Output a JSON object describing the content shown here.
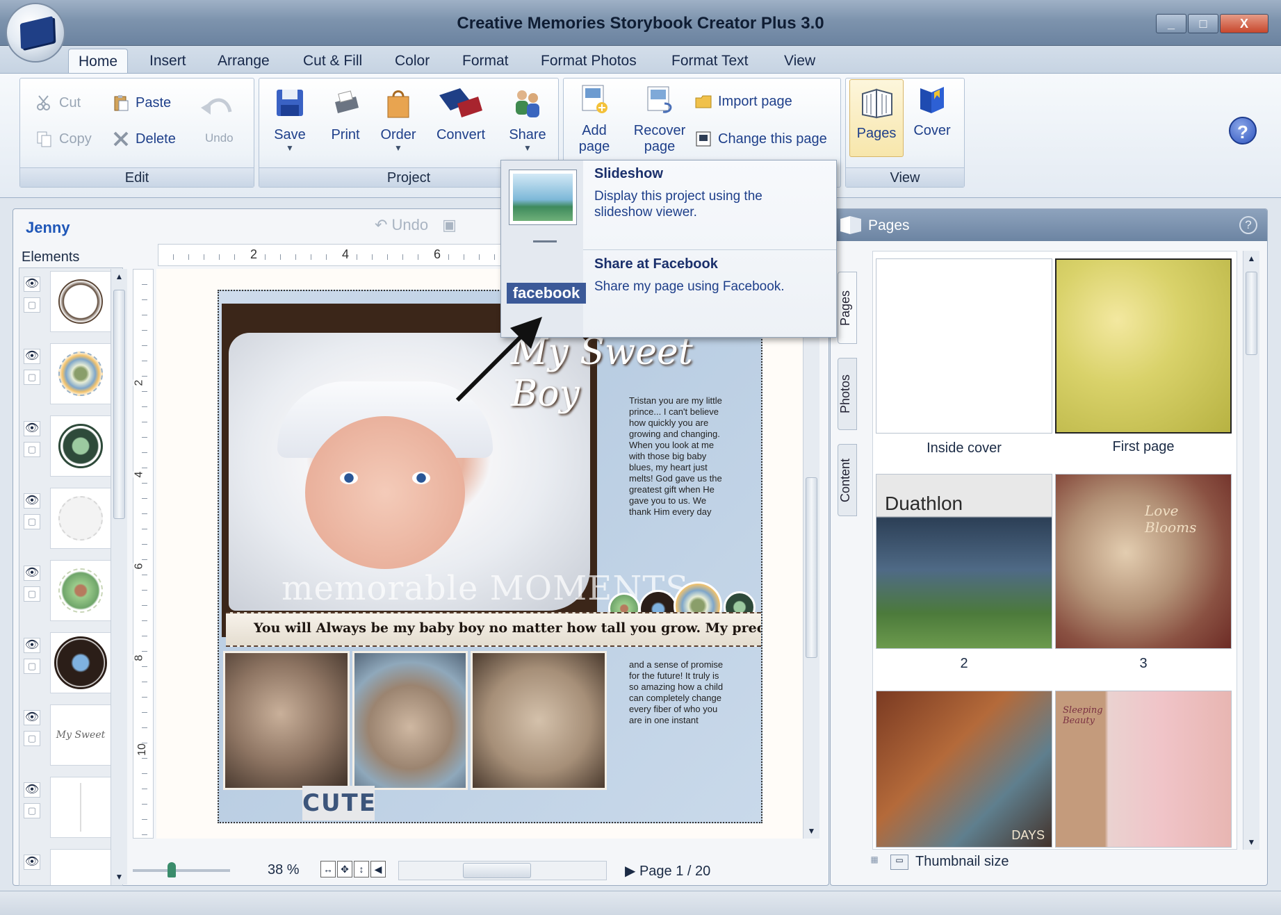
{
  "window": {
    "title": "Creative Memories Storybook Creator Plus 3.0"
  },
  "tabs": [
    "Home",
    "Insert",
    "Arrange",
    "Cut & Fill",
    "Color",
    "Format",
    "Format Photos",
    "Format Text",
    "View"
  ],
  "ribbon": {
    "edit": {
      "cut": "Cut",
      "copy": "Copy",
      "paste": "Paste",
      "delete": "Delete",
      "undo": "Undo",
      "label": "Edit"
    },
    "project": {
      "save": "Save",
      "print": "Print",
      "order": "Order",
      "convert": "Convert",
      "share": "Share",
      "label": "Project"
    },
    "page": {
      "add_page_1": "Add",
      "add_page_2": "page",
      "recover_page_1": "Recover",
      "recover_page_2": "page",
      "import_page": "Import page",
      "change_page": "Change this page"
    },
    "view": {
      "pages": "Pages",
      "cover": "Cover",
      "label": "View"
    }
  },
  "editor": {
    "user": "Jenny",
    "undo": "Undo",
    "elements_label": "Elements",
    "ruler_h": [
      "2",
      "4",
      "6"
    ],
    "ruler_v": [
      "2",
      "4",
      "6",
      "8",
      "10"
    ],
    "zoom": "38 %",
    "page_info": "Page 1 / 20"
  },
  "scrapbook": {
    "title_art": "My Sweet Boy",
    "journal_1": "Tristan you are my little prince... I can't believe how quickly you are growing and changing. When you look at me with those big baby blues, my heart just melts! God gave us the greatest gift when He gave you to us. We thank Him every day",
    "journal_2": "and a sense of promise for the future! It truly is so amazing how a child can completely change every fiber of who you are in one instant",
    "moments": "memorable MOMENTS",
    "caption": "You will Always be my baby boy no matter how tall you grow. My precious blue eyed boy!",
    "cute": "CUTE"
  },
  "pages_panel": {
    "title": "Pages",
    "help": "?",
    "side_tabs": [
      "Pages",
      "Photos",
      "Content"
    ],
    "thumbs": [
      {
        "label": "Inside cover"
      },
      {
        "label": "First page"
      },
      {
        "label": "2",
        "text": "Duathlon"
      },
      {
        "label": "3",
        "text": "Love Blooms"
      },
      {
        "label": "",
        "text": "DAYS"
      },
      {
        "label": "",
        "text": "Sleeping Beauty"
      }
    ],
    "thumbnail_size": "Thumbnail size"
  },
  "share_popup": {
    "slideshow_title": "Slideshow",
    "slideshow_desc": "Display this project using the slideshow viewer.",
    "facebook_title": "Share at Facebook",
    "facebook_desc": "Share my page using Facebook.",
    "facebook_logo": "facebook"
  },
  "colors": {
    "accent": "#1e3f8a",
    "facebook": "#3b5998",
    "title_bar": "#7d93ad"
  }
}
